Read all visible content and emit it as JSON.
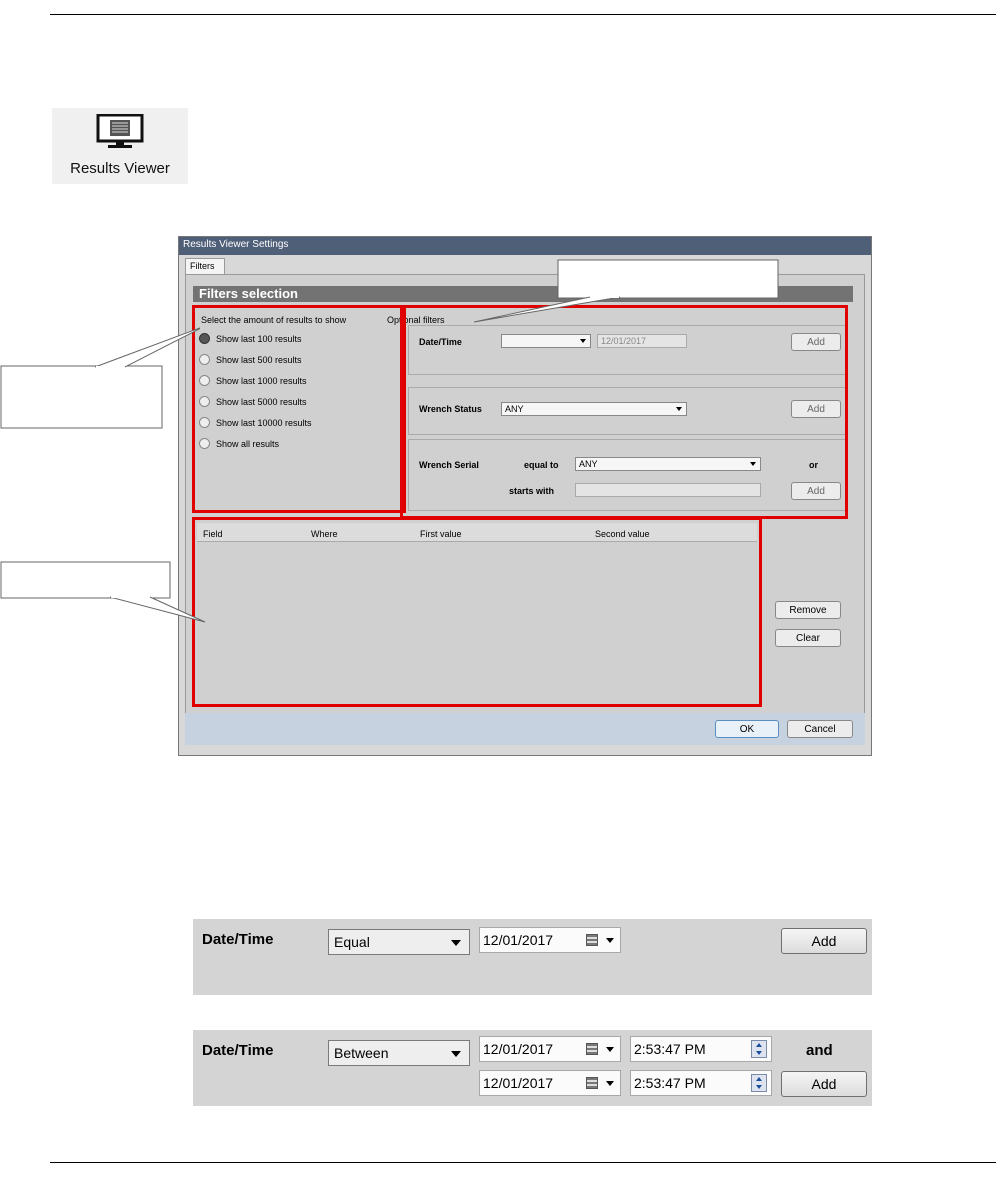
{
  "toolbar_icon": {
    "label": "Results Viewer",
    "icon": "monitor-icon"
  },
  "dialog": {
    "title": "Results Viewer Settings",
    "tab": "Filters",
    "section_header": "Filters selection",
    "amount_group": {
      "title": "Select the amount of results to show",
      "options": [
        "Show last 100 results",
        "Show last 500 results",
        "Show last 1000 results",
        "Show last 5000 results",
        "Show last 10000 results",
        "Show all results"
      ],
      "selected_index": 0
    },
    "optional_filters": {
      "title": "Optional filters",
      "datetime": {
        "label": "Date/Time",
        "condition": "",
        "date": "12/01/2017",
        "add": "Add"
      },
      "wrench_status": {
        "label": "Wrench Status",
        "value": "ANY",
        "add": "Add"
      },
      "wrench_serial": {
        "label": "Wrench Serial",
        "equal_to_label": "equal to",
        "equal_to_value": "ANY",
        "or_label": "or",
        "starts_with_label": "starts with",
        "starts_with_value": "",
        "add": "Add"
      }
    },
    "grid": {
      "columns": [
        "Field",
        "Where",
        "First value",
        "Second value"
      ]
    },
    "remove": "Remove",
    "clear": "Clear",
    "ok": "OK",
    "cancel": "Cancel"
  },
  "zoom_equal": {
    "label": "Date/Time",
    "condition": "Equal",
    "date": "12/01/2017",
    "add": "Add"
  },
  "zoom_between": {
    "label": "Date/Time",
    "condition": "Between",
    "date1": "12/01/2017",
    "time1": "2:53:47 PM",
    "and_label": "and",
    "date2": "12/01/2017",
    "time2": "2:53:47 PM",
    "add": "Add"
  },
  "colors": {
    "highlight": "#e00000",
    "callout_fill": "#ffffff",
    "panel": "#d0d0d0"
  }
}
